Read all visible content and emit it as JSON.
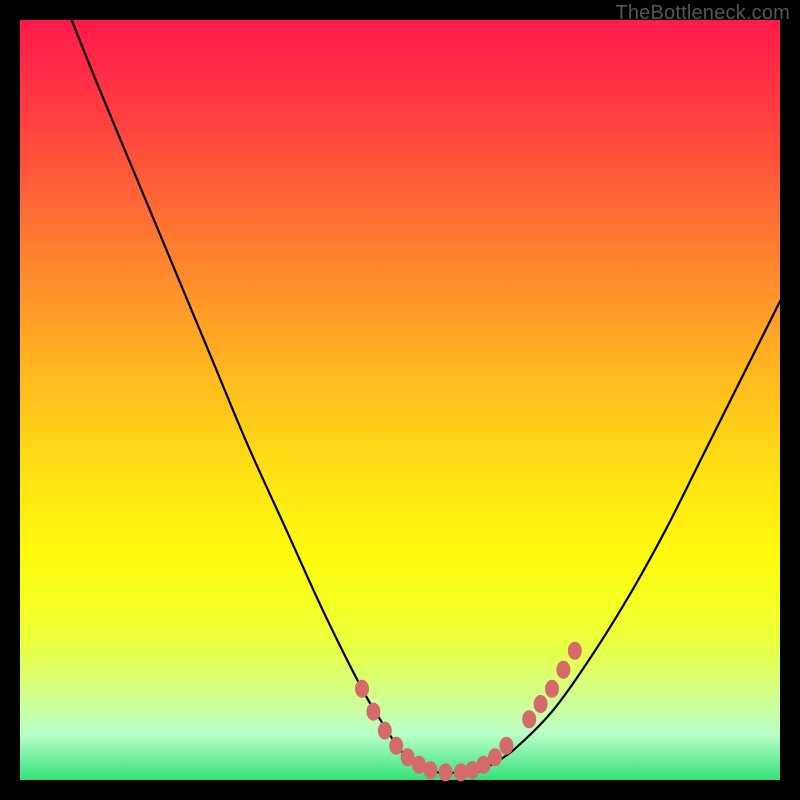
{
  "watermark": {
    "text": "TheBottleneck.com"
  },
  "chart_data": {
    "type": "line",
    "title": "",
    "xlabel": "",
    "ylabel": "",
    "xlim": [
      0,
      100
    ],
    "ylim": [
      0,
      100
    ],
    "series": [
      {
        "name": "curve",
        "x": [
          6,
          10,
          15,
          20,
          25,
          30,
          35,
          40,
          45,
          48,
          50,
          52,
          55,
          58,
          60,
          62,
          65,
          70,
          75,
          80,
          85,
          90,
          95,
          100
        ],
        "y": [
          102,
          92,
          80,
          68,
          56,
          44,
          33,
          22,
          12,
          7,
          4,
          2,
          1,
          1,
          1,
          2,
          4,
          9,
          16,
          24,
          33,
          43,
          53,
          63
        ]
      }
    ],
    "markers": [
      {
        "x": 45.0,
        "y": 12.0
      },
      {
        "x": 46.5,
        "y": 9.0
      },
      {
        "x": 48.0,
        "y": 6.5
      },
      {
        "x": 49.5,
        "y": 4.5
      },
      {
        "x": 51.0,
        "y": 3.0
      },
      {
        "x": 52.5,
        "y": 2.0
      },
      {
        "x": 54.0,
        "y": 1.3
      },
      {
        "x": 56.0,
        "y": 1.0
      },
      {
        "x": 58.0,
        "y": 1.0
      },
      {
        "x": 59.5,
        "y": 1.3
      },
      {
        "x": 61.0,
        "y": 2.0
      },
      {
        "x": 62.5,
        "y": 3.0
      },
      {
        "x": 64.0,
        "y": 4.5
      },
      {
        "x": 67.0,
        "y": 8.0
      },
      {
        "x": 68.5,
        "y": 10.0
      },
      {
        "x": 70.0,
        "y": 12.0
      },
      {
        "x": 71.5,
        "y": 14.5
      },
      {
        "x": 73.0,
        "y": 17.0
      }
    ],
    "colors": {
      "curve": "#000000",
      "marker": "#d46a6a"
    }
  }
}
